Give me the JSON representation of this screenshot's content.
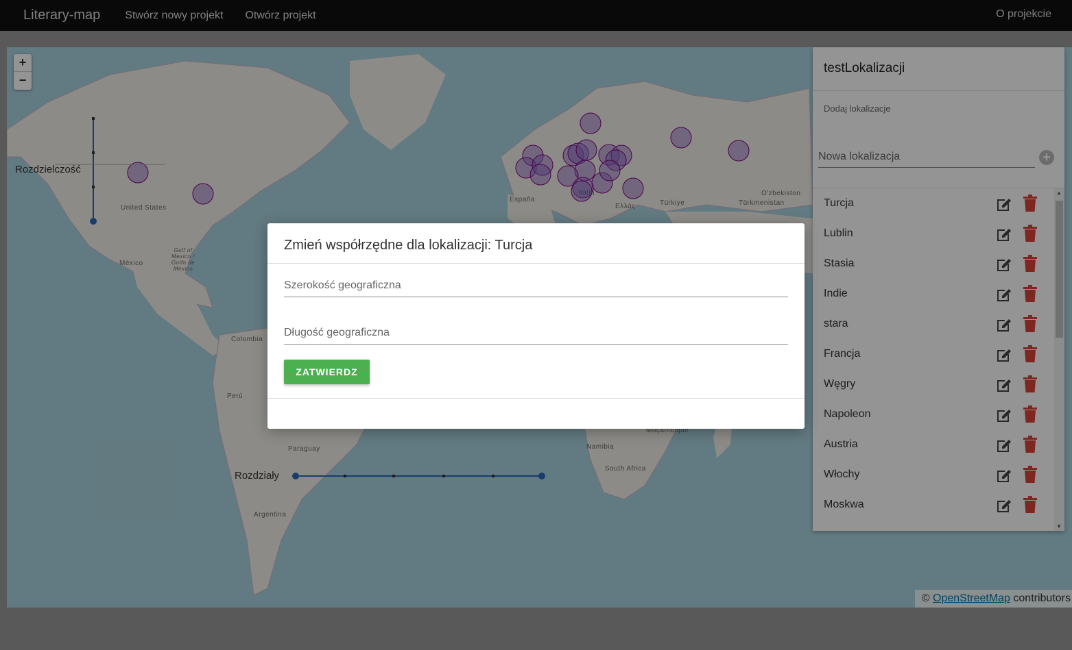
{
  "navbar": {
    "brand": "Literary-map",
    "links": [
      "Stwórz nowy projekt",
      "Otwórz projekt"
    ],
    "right_link": "O projekcie"
  },
  "map": {
    "zoom_in": "+",
    "zoom_out": "−",
    "resolution_label": "Rozdzielczość",
    "divisions_label": "Rozdziały",
    "country_labels": [
      "United States",
      "México",
      "Gulf of Mexico / Golfo de México",
      "Colombia",
      "Perú",
      "Paraguay",
      "Argentina",
      "España",
      "Italia",
      "Ελλάς",
      "Türkiye",
      "Türkmenistan",
      "O'zbekiston",
      "Moçambique",
      "Namibia",
      "South Africa"
    ],
    "attribution_prefix": "©",
    "attribution_link": "OpenStreetMap",
    "attribution_suffix": "contributors",
    "marker_color": "#800080"
  },
  "panel": {
    "title": "testLokalizacji",
    "add_label": "Dodaj lokalizacje",
    "add_placeholder": "Nowa lokalizacja",
    "locations": [
      "Turcja",
      "Lublin",
      "Stasia",
      "Indie",
      "stara",
      "Francja",
      "Węgry",
      "Napoleon",
      "Austria",
      "Włochy",
      "Moskwa"
    ]
  },
  "modal": {
    "title": "Zmień współrzędne dla lokalizacji: Turcja",
    "lat_placeholder": "Szerokość geograficzna",
    "lng_placeholder": "Długość geograficzna",
    "submit_label": "ZATWIERDZ"
  },
  "colors": {
    "navbar": "#111111",
    "submit": "#4caf50",
    "delete_icon": "#d9443a",
    "slider": "#2a6ab8"
  }
}
